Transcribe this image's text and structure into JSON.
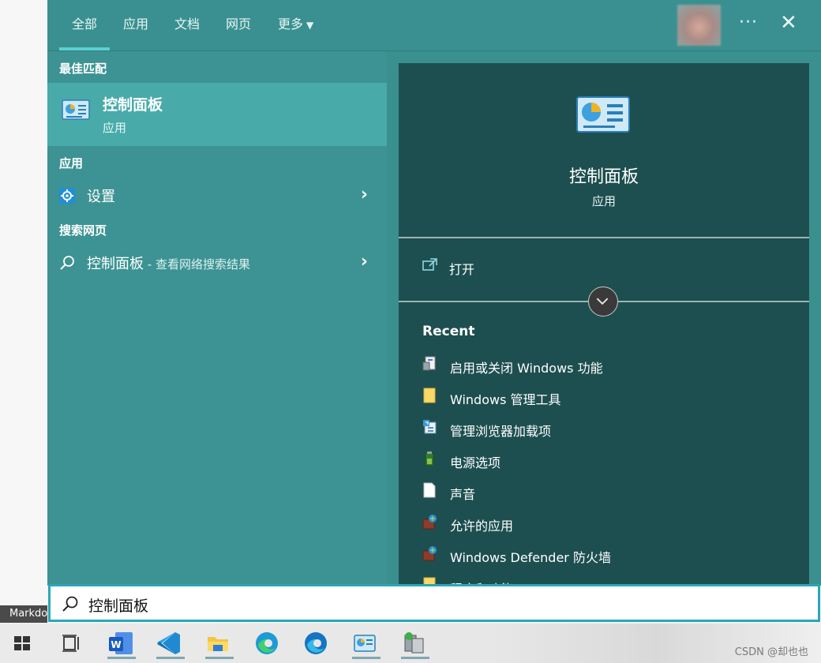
{
  "background": {
    "left_tag": "Markdo"
  },
  "tabs": [
    {
      "label": "全部"
    },
    {
      "label": "应用"
    },
    {
      "label": "文档"
    },
    {
      "label": "网页"
    },
    {
      "label": "更多"
    }
  ],
  "header_icons": {
    "more": "···",
    "close": "✕"
  },
  "left": {
    "best_match_heading": "最佳匹配",
    "best_match": {
      "title": "控制面板",
      "subtitle": "应用"
    },
    "apps_heading": "应用",
    "settings_label": "设置",
    "web_heading": "搜索网页",
    "web_result": {
      "label": "控制面板",
      "suffix": " - 查看网络搜索结果"
    }
  },
  "right": {
    "title": "控制面板",
    "subtitle": "应用",
    "open_label": "打开",
    "recent_heading": "Recent",
    "recent": [
      {
        "label": "启用或关闭 Windows 功能",
        "icon": "windows-features-icon"
      },
      {
        "label": "Windows 管理工具",
        "icon": "folder-icon"
      },
      {
        "label": "管理浏览器加载项",
        "icon": "browser-addons-icon"
      },
      {
        "label": "电源选项",
        "icon": "battery-icon"
      },
      {
        "label": "声音",
        "icon": "document-icon"
      },
      {
        "label": "允许的应用",
        "icon": "firewall-icon"
      },
      {
        "label": "Windows Defender 防火墙",
        "icon": "firewall-icon"
      },
      {
        "label": "程序和功能",
        "icon": "folder-icon"
      }
    ]
  },
  "search": {
    "value": "控制面板"
  },
  "taskbar": {
    "items": [
      "windows-start",
      "task-view",
      "word",
      "vscode",
      "file-explorer",
      "edge",
      "edge-dev",
      "control-panel",
      "network-app"
    ]
  },
  "credit": "CSDN @却也也",
  "colors": {
    "panel": "#3a8f8f",
    "selected": "#49aaaa",
    "preview": "#1e4f50",
    "accent": "#5bd0d0"
  }
}
